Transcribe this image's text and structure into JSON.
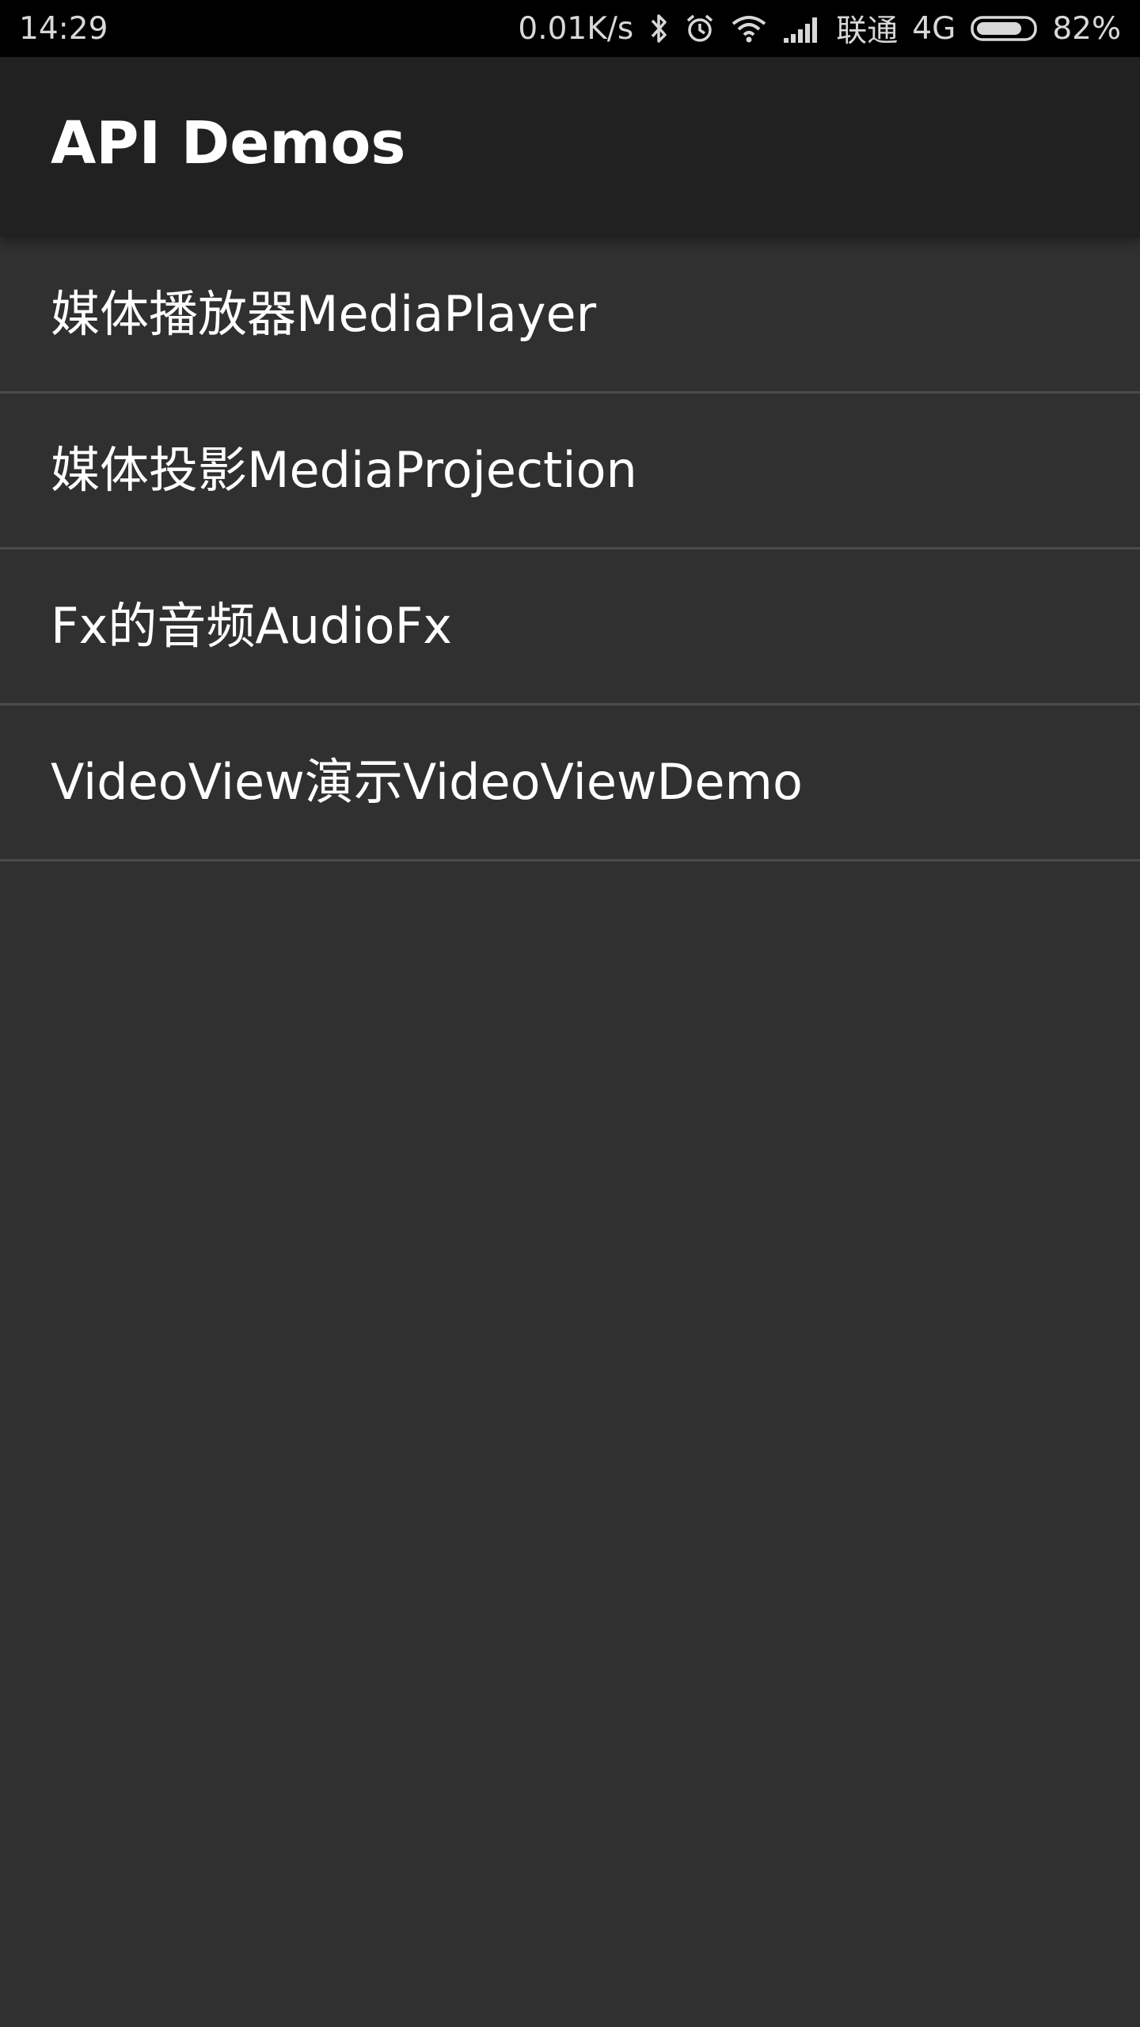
{
  "status_bar": {
    "time": "14:29",
    "net_speed": "0.01K/s",
    "carrier": "联通",
    "network_type": "4G",
    "battery": "82%",
    "battery_level": 0.82,
    "icons": [
      "bluetooth-icon",
      "alarm-icon",
      "wifi-icon",
      "signal-icon",
      "battery-icon"
    ]
  },
  "app_bar": {
    "title": "API Demos"
  },
  "list": {
    "items": [
      {
        "label": "媒体播放器MediaPlayer"
      },
      {
        "label": "媒体投影MediaProjection"
      },
      {
        "label": "Fx的音频AudioFx"
      },
      {
        "label": "VideoView演示VideoViewDemo"
      }
    ]
  },
  "colors": {
    "status_bar_bg": "#000000",
    "app_bar_bg": "#212121",
    "background": "#303030",
    "divider": "#4b4b4b",
    "text": "#ffffff"
  }
}
